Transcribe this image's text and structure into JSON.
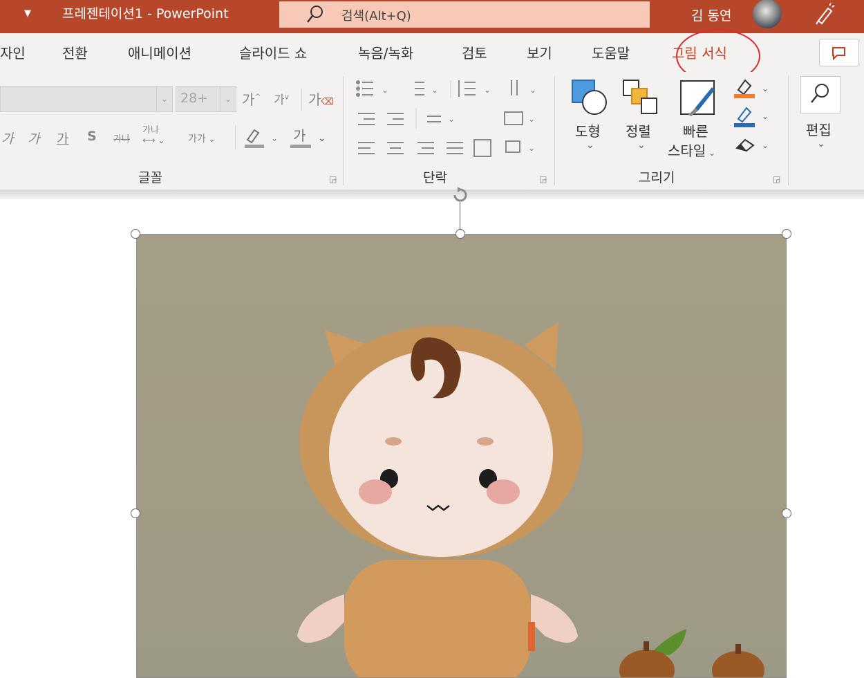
{
  "titlebar": {
    "document_title": "프레젠테이션1  -  PowerPoint",
    "search_placeholder": "검색(Alt+Q)",
    "user_name": "김 동연",
    "qat_icon": "chevron-down-icon",
    "pen_icon": "pen-icon"
  },
  "tabs": [
    "자인",
    "전환",
    "애니메이션",
    "슬라이드 쇼",
    "녹음/녹화",
    "검토",
    "보기",
    "도움말",
    "그림 서식"
  ],
  "ribbon": {
    "font_group": {
      "label": "글꼴",
      "font_size": "28+",
      "grow_font": "가",
      "shrink_font": "가",
      "clear_format": "가",
      "italic": "가",
      "underline": "가",
      "strikethrough": "가",
      "shadow": "S",
      "char_spacing": "가나",
      "change_case": "가가",
      "font_color": "가"
    },
    "paragraph_group": {
      "label": "단락"
    },
    "drawing_group": {
      "label": "그리기",
      "shapes": "도형",
      "arrange": "정렬",
      "quick_styles_1": "빠른",
      "quick_styles_2": "스타일"
    },
    "editing_group": {
      "label": "편집"
    }
  },
  "colors": {
    "titlebar": "#b7472a",
    "search_box": "#f7c9b6",
    "accent_tab": "#c43e1c",
    "annotation_circle": "#e0282f",
    "ribbon_bg": "#f3f2f1"
  }
}
